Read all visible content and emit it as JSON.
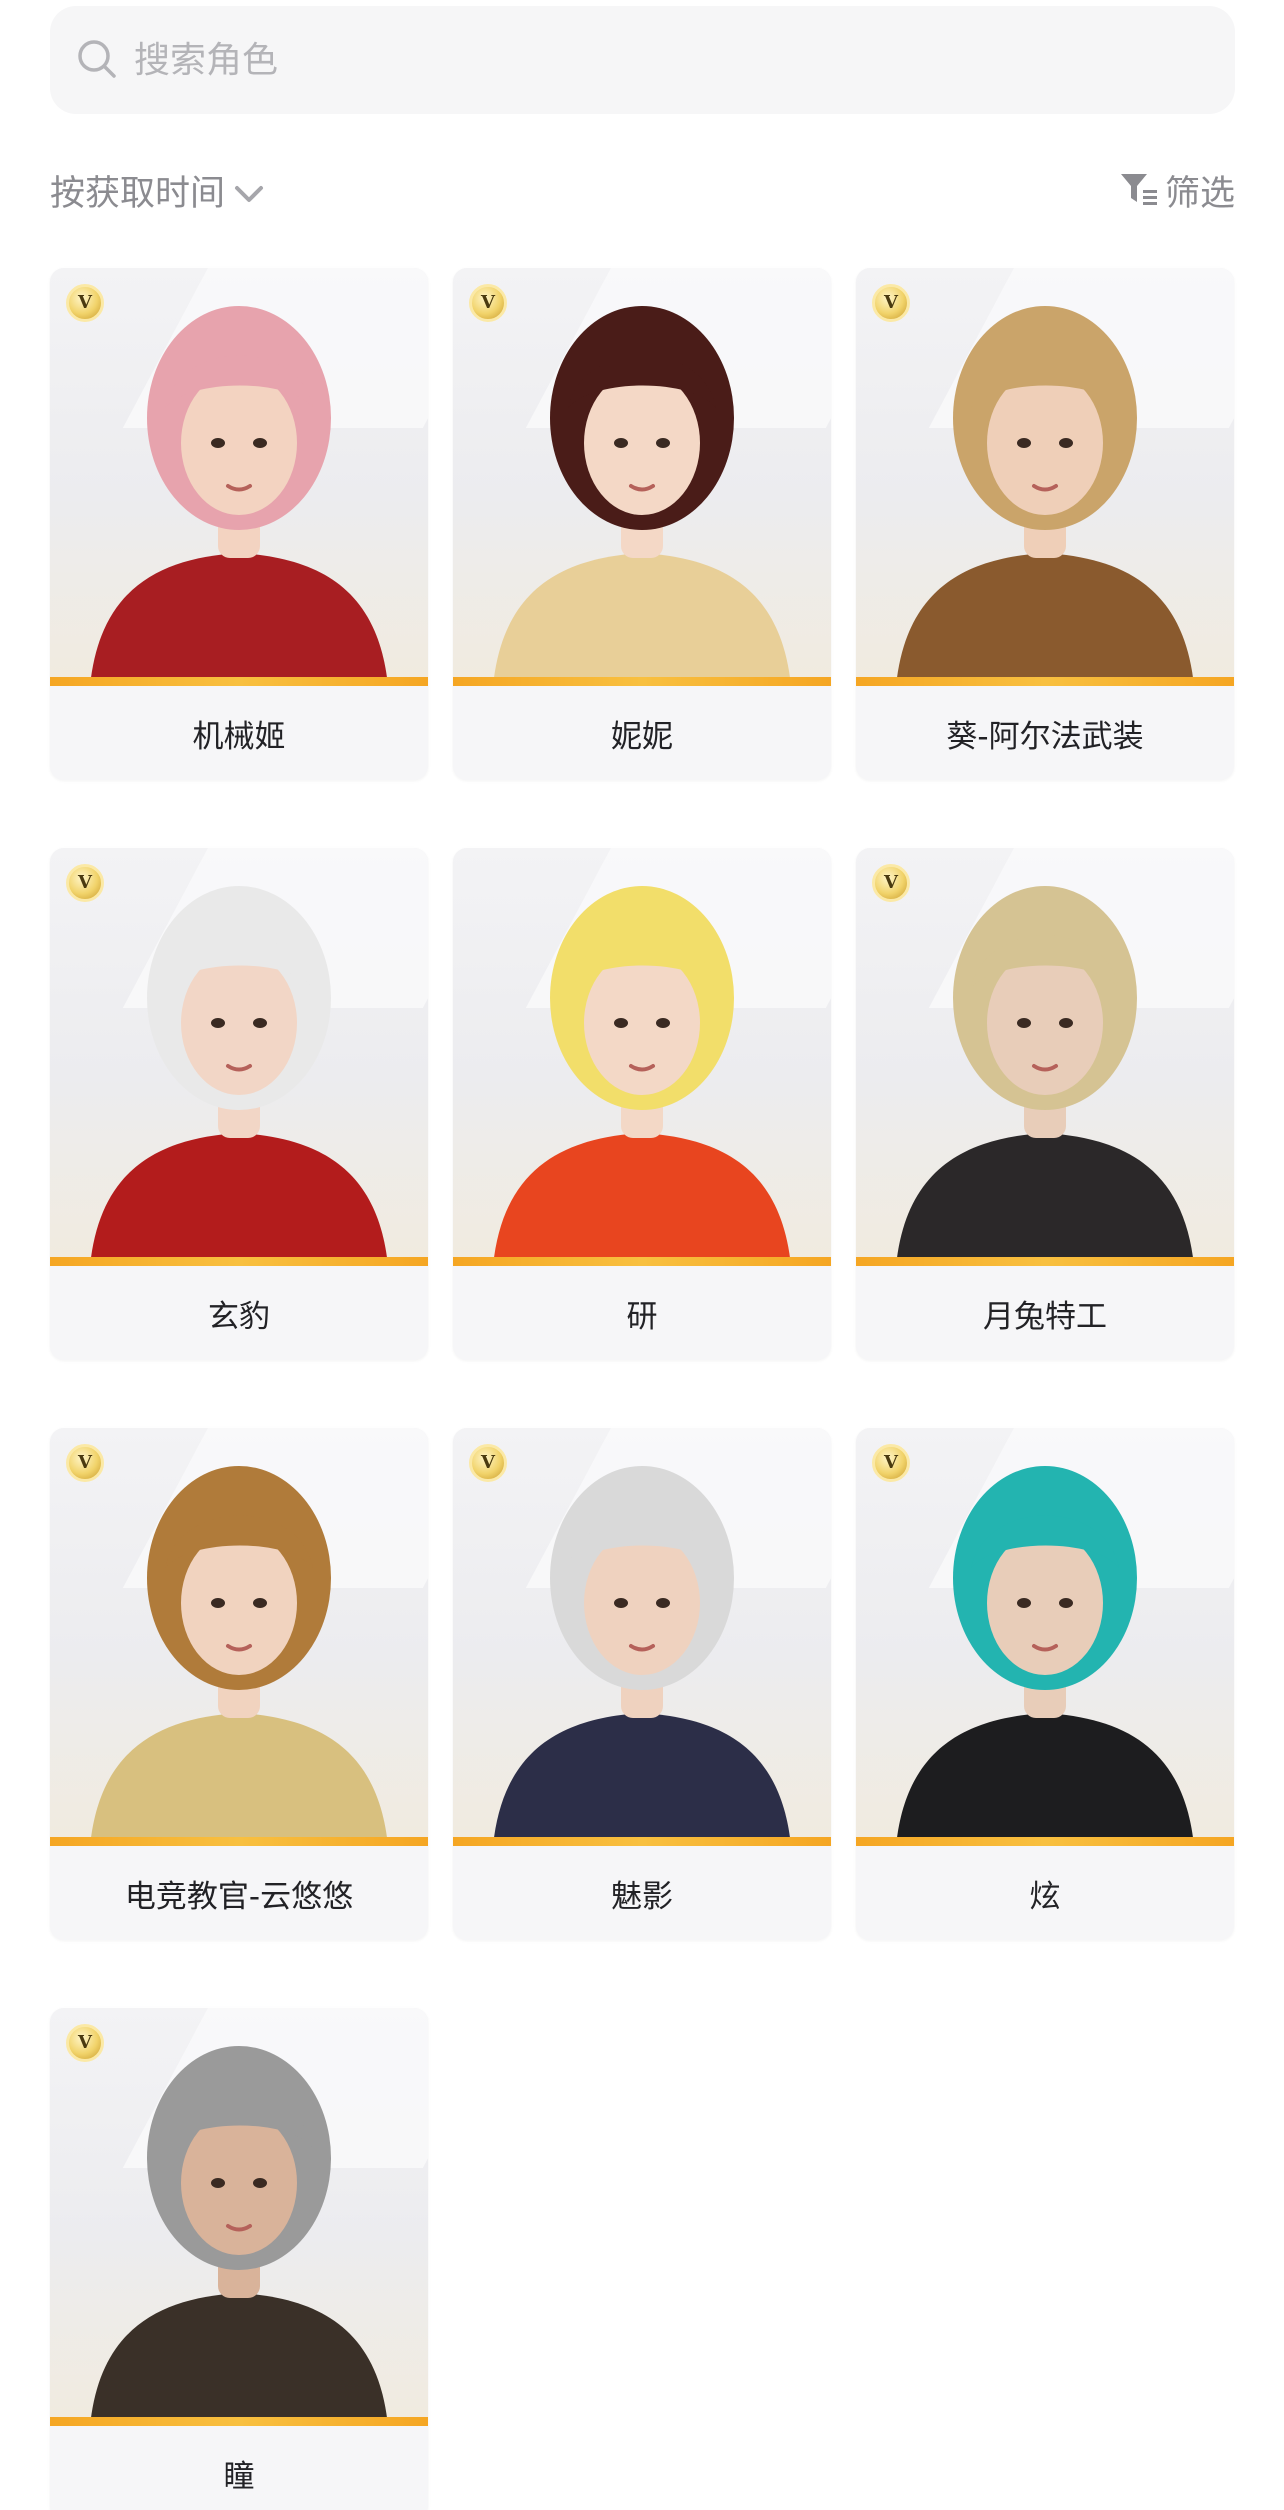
{
  "search": {
    "placeholder": "搜索角色",
    "icon": "search-icon"
  },
  "sort": {
    "label": "按获取时间",
    "icon": "chevron-down-icon"
  },
  "filter": {
    "label": "筛选",
    "icon": "filter-icon"
  },
  "colors": {
    "accent_bar": "#f5a623",
    "card_bg": "#f6f6f8",
    "muted_text": "#8b8b90",
    "name_text": "#222226"
  },
  "characters": [
    {
      "name": "机械姬",
      "badge": "V",
      "hair": "#e7a3ad",
      "outfit": "#a81e22",
      "skin": "#f3d3c1"
    },
    {
      "name": "妮妮",
      "badge": "V",
      "hair": "#4a1c18",
      "outfit": "#e8cf98",
      "skin": "#f4d8c6"
    },
    {
      "name": "葵-阿尔法武装",
      "badge": "V",
      "hair": "#caa46a",
      "outfit": "#8a5a2e",
      "skin": "#efcfb8"
    },
    {
      "name": "玄豹",
      "badge": "V",
      "hair": "#e9e9e9",
      "outfit": "#b31c1c",
      "skin": "#f2d6c6"
    },
    {
      "name": "研",
      "badge": "",
      "hair": "#f2de6a",
      "outfit": "#e8451f",
      "skin": "#f3d8c6"
    },
    {
      "name": "月兔特工",
      "badge": "V",
      "hair": "#d5c393",
      "outfit": "#2b2829",
      "skin": "#e8cdb9"
    },
    {
      "name": "电竞教官-云悠悠",
      "badge": "V",
      "hair": "#b07b3a",
      "outfit": "#d8c07f",
      "skin": "#f1d3bf"
    },
    {
      "name": "魅影",
      "badge": "V",
      "hair": "#d9d9d9",
      "outfit": "#2c2e48",
      "skin": "#efd2bf"
    },
    {
      "name": "炫",
      "badge": "V",
      "hair": "#23b4b0",
      "outfit": "#1d1d1f",
      "skin": "#e8cdb9"
    },
    {
      "name": "瞳",
      "badge": "V",
      "hair": "#9a9a9a",
      "outfit": "#3a3028",
      "skin": "#d9b39a"
    }
  ]
}
